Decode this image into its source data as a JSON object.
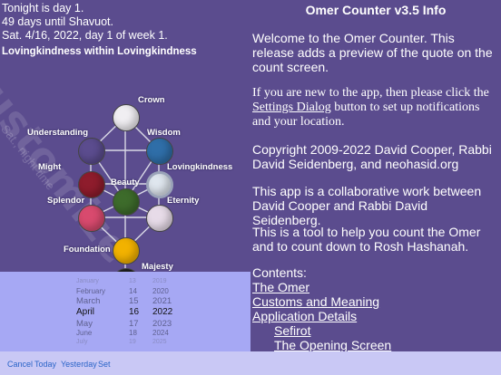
{
  "status": {
    "line1": "Tonight is day 1.",
    "line2": "49 days until Shavuot.",
    "line3": "Sat. 4/16, 2022, day 1 of week 1.",
    "quality": "Lovingkindness within Lovingkindness"
  },
  "watermark": {
    "text": "Customize",
    "subtext": "Sat., night time"
  },
  "tree": {
    "crown": "Crown",
    "understanding": "Understanding",
    "wisdom": "Wisdom",
    "might": "Might",
    "lovingkindness": "Lovingkindness",
    "beauty": "Beauty",
    "splendor": "Splendor",
    "eternity": "Eternity",
    "foundation": "Foundation",
    "majesty": "Majesty",
    "colors": {
      "crown": "#f0eef2",
      "wisdom": "#2f6ea8",
      "understanding": "#5b4c8e",
      "lovingkindness": "#dfe6ee",
      "might": "#8e1c2c",
      "beauty": "#3d6b2b",
      "eternity": "#e7dbe8",
      "splendor": "#d84a6e",
      "foundation": "#f2b200",
      "majesty": "#1e1e1e"
    }
  },
  "picker": {
    "months": [
      "January",
      "February",
      "March",
      "April",
      "May",
      "June",
      "July"
    ],
    "days": [
      "13",
      "14",
      "15",
      "16",
      "17",
      "18",
      "19"
    ],
    "years": [
      "2019",
      "2020",
      "2021",
      "2022",
      "2023",
      "2024",
      "2025"
    ],
    "selected": {
      "month": "April",
      "day": "16",
      "year": "2022"
    }
  },
  "toolbar": {
    "cancel": "Cancel",
    "today": "Today",
    "yesterday": "Yesterday",
    "set": "Set"
  },
  "info": {
    "title": "Omer Counter v3.5 Info",
    "welcome": "Welcome to the Omer Counter. This release adds a preview of the quote on the count screen.",
    "new_before": "If you are new to the app, then please click the ",
    "new_link": "Settings Dialog",
    "new_after": " button to set up notifications and your location.",
    "copyright": "Copyright 2009-2022 David Cooper, Rabbi David Seidenberg, and neohasid.org",
    "collab": "This app is a collaborative work between David Cooper and Rabbi David Seidenberg.",
    "tool": "This is a tool to help you count the Omer and to count down to Rosh Hashanah.",
    "contents": "Contents:",
    "links": [
      "The Omer",
      "Customs and Meaning",
      "Application Details",
      "Sefirot",
      "The Opening Screen"
    ]
  }
}
